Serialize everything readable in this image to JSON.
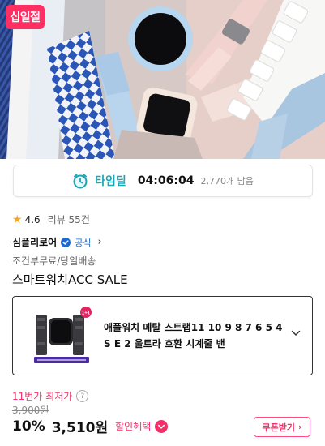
{
  "hero": {
    "badge": "십일절",
    "colors": {
      "badge": "#ff2e63",
      "background": "#d8c8c2"
    }
  },
  "timedeal": {
    "icon": "alarm-clock-icon",
    "label": "타임딜",
    "time": "04:06:04",
    "remaining": "2,770개 남음",
    "accent": "#1aa7b5"
  },
  "rating": {
    "icon": "star-icon",
    "value": "4.6",
    "review_link": "리뷰 55건"
  },
  "seller": {
    "name": "심플리로어",
    "badge_icon": "verified-check-icon",
    "badge_label": "공식",
    "chevron": "›"
  },
  "shipping": "조건부무료/당일배송",
  "product": {
    "title": "스마트워치ACC SALE"
  },
  "option": {
    "name": "애플워치 메탈 스트랩11 10 9 8 7 6 5 4 S E 2 울트라 호환 시계줄 밴",
    "thumb_icon": "watch-product-thumbnail",
    "chevron_icon": "chevron-down-icon"
  },
  "pricing": {
    "lowest_label": "11번가 최저가",
    "help_icon": "question-circle-icon",
    "help_glyph": "?",
    "original_price": "3,900원",
    "discount": "10%",
    "price": "3,510원",
    "benefit_label": "할인혜택",
    "benefit_icon": "chevron-down-circle-icon",
    "accent": "#f2316a"
  },
  "coupon": {
    "label": "쿠폰받기",
    "chevron": "›"
  }
}
